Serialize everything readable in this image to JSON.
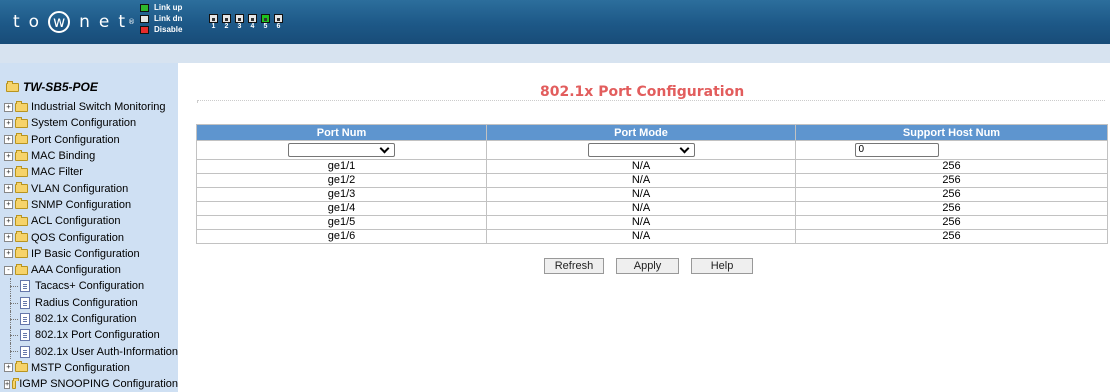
{
  "header": {
    "logo": {
      "letters": [
        "t",
        "o",
        "w",
        "n",
        "e",
        "t"
      ],
      "registered": "®"
    },
    "legend": [
      {
        "label": "Link up",
        "color": "#2eb82e"
      },
      {
        "label": "Link dn",
        "color": "#e6e6e6"
      },
      {
        "label": "Disable",
        "color": "#e62b2b"
      }
    ],
    "ports": [
      {
        "num": "1",
        "status": "down"
      },
      {
        "num": "2",
        "status": "down"
      },
      {
        "num": "3",
        "status": "down"
      },
      {
        "num": "4",
        "status": "down"
      },
      {
        "num": "5",
        "status": "up"
      },
      {
        "num": "6",
        "status": "down"
      }
    ]
  },
  "sidebar": {
    "root": "TW-SB5-POE",
    "items": [
      {
        "label": "Industrial Switch Monitoring",
        "expand": "+"
      },
      {
        "label": "System Configuration",
        "expand": "+"
      },
      {
        "label": "Port Configuration",
        "expand": "+"
      },
      {
        "label": "MAC Binding",
        "expand": "+"
      },
      {
        "label": "MAC Filter",
        "expand": "+"
      },
      {
        "label": "VLAN Configuration",
        "expand": "+"
      },
      {
        "label": "SNMP Configuration",
        "expand": "+"
      },
      {
        "label": "ACL Configuration",
        "expand": "+"
      },
      {
        "label": "QOS Configuration",
        "expand": "+"
      },
      {
        "label": "IP Basic Configuration",
        "expand": "+"
      },
      {
        "label": "AAA Configuration",
        "expand": "-"
      },
      {
        "label": "Tacacs+ Configuration",
        "child": true
      },
      {
        "label": "Radius Configuration",
        "child": true
      },
      {
        "label": "802.1x Configuration",
        "child": true
      },
      {
        "label": "802.1x Port Configuration",
        "child": true
      },
      {
        "label": "802.1x User Auth-Information",
        "child": true
      },
      {
        "label": "MSTP Configuration",
        "expand": "+"
      },
      {
        "label": "IGMP SNOOPING Configuration",
        "expand": "+"
      }
    ]
  },
  "main": {
    "title": "802.1x Port Configuration",
    "columns": [
      "Port Num",
      "Port Mode",
      "Support Host Num"
    ],
    "filter": {
      "port_num": "",
      "port_mode": "",
      "host_num": "0"
    },
    "rows": [
      [
        "ge1/1",
        "N/A",
        "256"
      ],
      [
        "ge1/2",
        "N/A",
        "256"
      ],
      [
        "ge1/3",
        "N/A",
        "256"
      ],
      [
        "ge1/4",
        "N/A",
        "256"
      ],
      [
        "ge1/5",
        "N/A",
        "256"
      ],
      [
        "ge1/6",
        "N/A",
        "256"
      ]
    ],
    "buttons": {
      "refresh": "Refresh",
      "apply": "Apply",
      "help": "Help"
    }
  }
}
